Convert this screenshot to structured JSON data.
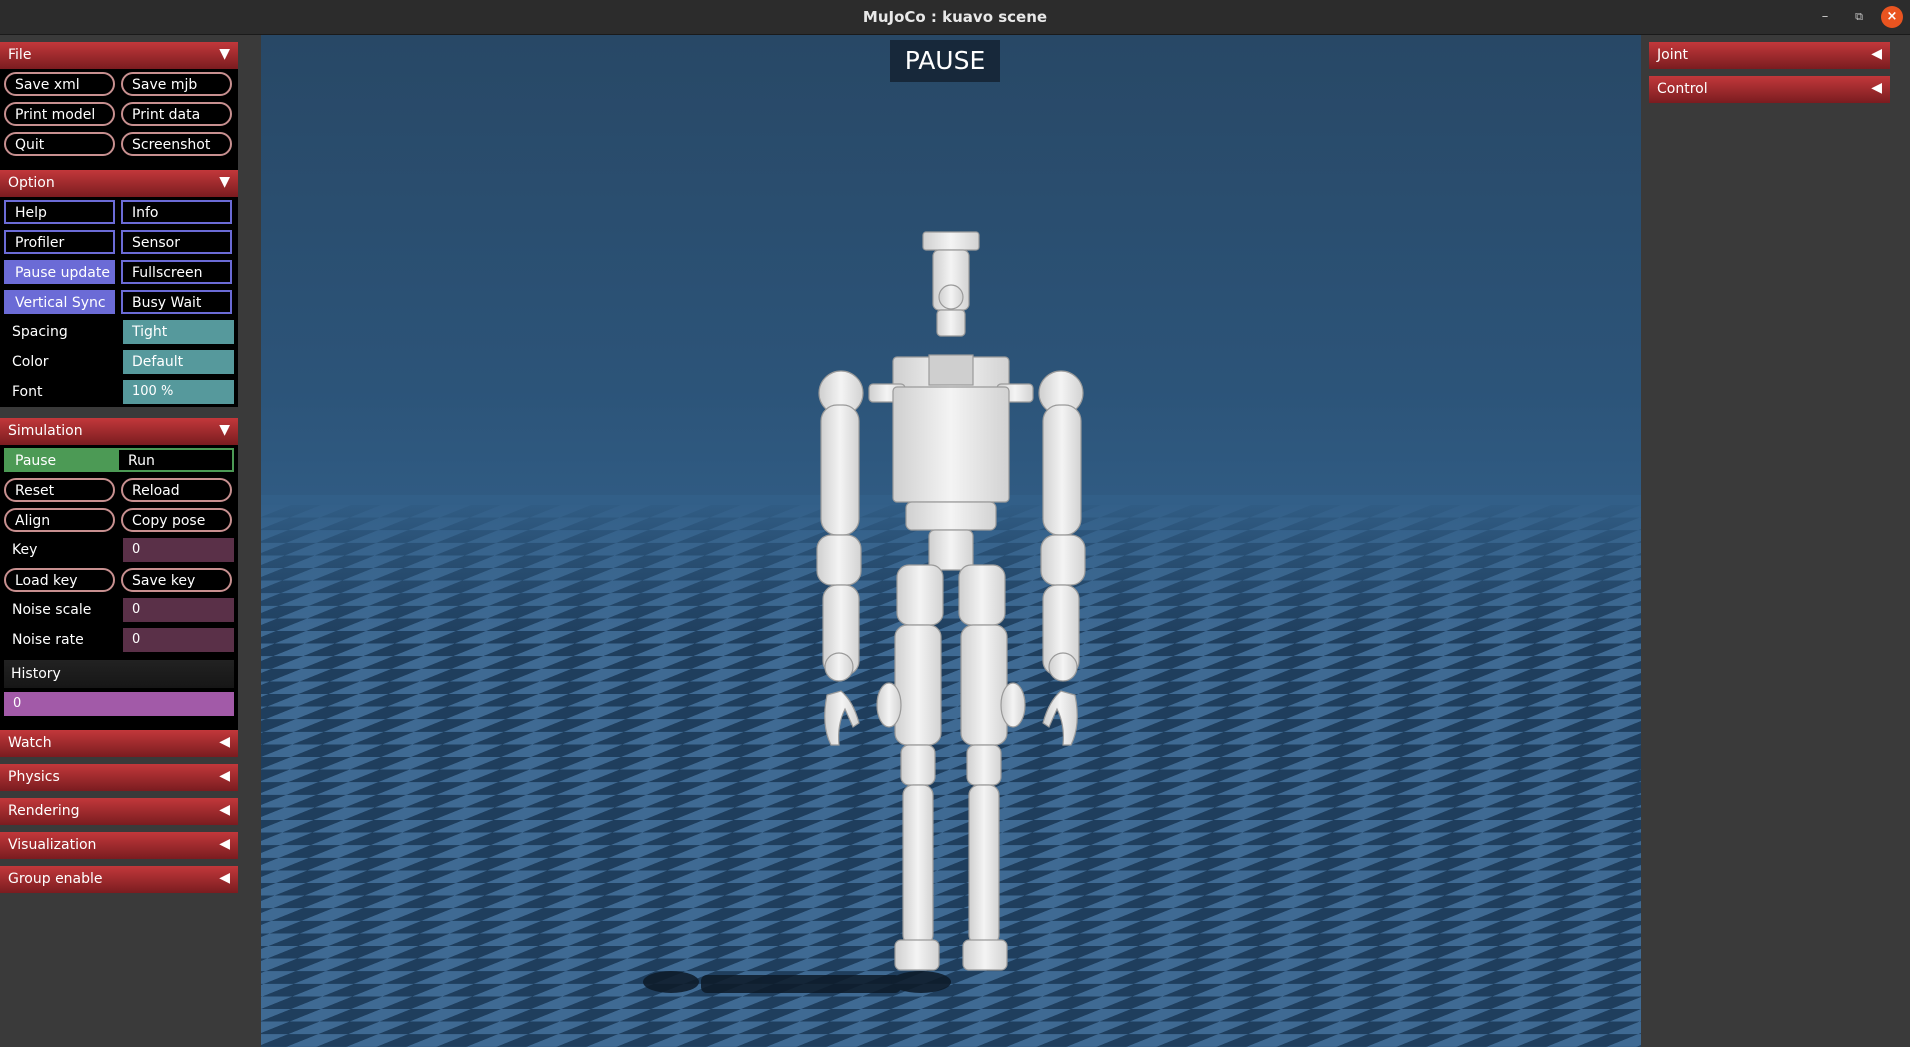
{
  "window": {
    "title": "MuJoCo : kuavo scene",
    "minimize_icon": "minimize-icon",
    "maximize_icon": "maximize-icon",
    "close_icon": "close-icon"
  },
  "colors": {
    "section_header": "#c2383b",
    "checkbox_on": "#6b6bd6",
    "radio_on": "#4c9a55",
    "select": "#56999c",
    "edit": "#5a3048",
    "slider": "#a25aa8",
    "viewport_sky": "#284866",
    "floor_light": "#3f6a93",
    "floor_dark": "#1d3a58"
  },
  "left_panel": {
    "file": {
      "header": "File",
      "arrow": "▼",
      "buttons": [
        "Save xml",
        "Save mjb",
        "Print model",
        "Print data",
        "Quit",
        "Screenshot"
      ]
    },
    "option": {
      "header": "Option",
      "arrow": "▼",
      "checks": [
        {
          "label": "Help",
          "on": false
        },
        {
          "label": "Info",
          "on": false
        },
        {
          "label": "Profiler",
          "on": false
        },
        {
          "label": "Sensor",
          "on": false
        },
        {
          "label": "Pause update",
          "on": true
        },
        {
          "label": "Fullscreen",
          "on": false
        },
        {
          "label": "Vertical Sync",
          "on": true
        },
        {
          "label": "Busy Wait",
          "on": false
        }
      ],
      "spacing_label": "Spacing",
      "spacing_value": "Tight",
      "color_label": "Color",
      "color_value": "Default",
      "font_label": "Font",
      "font_value": "100 %"
    },
    "simulation": {
      "header": "Simulation",
      "arrow": "▼",
      "pause_label": "Pause",
      "run_label": "Run",
      "buttons": [
        "Reset",
        "Reload",
        "Align",
        "Copy pose"
      ],
      "key_label": "Key",
      "key_value": "0",
      "load_key": "Load key",
      "save_key": "Save key",
      "noise_scale_label": "Noise scale",
      "noise_scale_value": "0",
      "noise_rate_label": "Noise rate",
      "noise_rate_value": "0",
      "history_label": "History",
      "history_value": "0"
    },
    "collapsed": [
      {
        "label": "Watch",
        "arrow": "◀"
      },
      {
        "label": "Physics",
        "arrow": "◀"
      },
      {
        "label": "Rendering",
        "arrow": "◀"
      },
      {
        "label": "Visualization",
        "arrow": "◀"
      },
      {
        "label": "Group enable",
        "arrow": "◀"
      }
    ]
  },
  "right_panel": {
    "sections": [
      {
        "label": "Joint",
        "arrow": "◀"
      },
      {
        "label": "Control",
        "arrow": "◀"
      }
    ]
  },
  "viewport": {
    "status": "PAUSE"
  }
}
